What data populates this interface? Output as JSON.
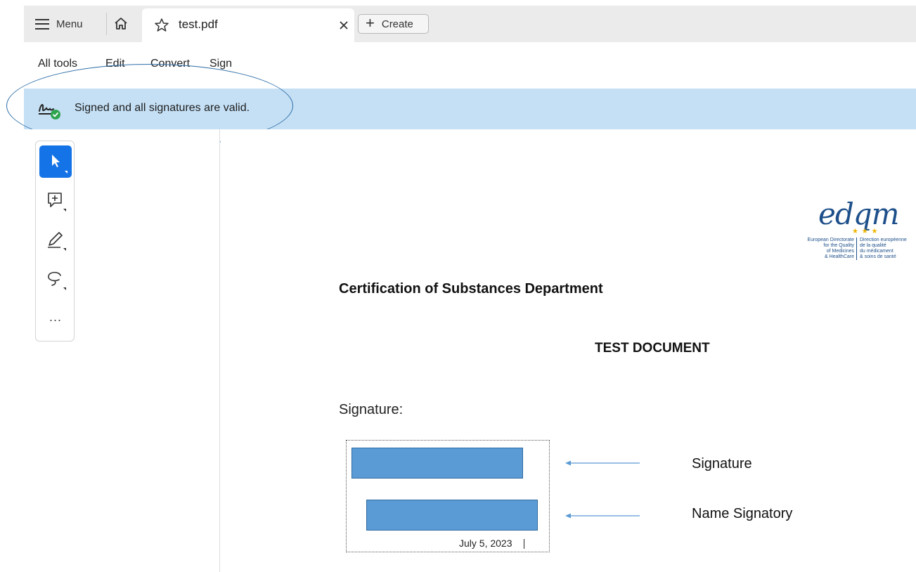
{
  "tabbar": {
    "menu_label": "Menu",
    "tab_title": "test.pdf",
    "create_label": "Create"
  },
  "menubar": {
    "items": [
      "All tools",
      "Edit",
      "Convert",
      "Sign"
    ]
  },
  "banner": {
    "text": "Signed and all signatures are valid."
  },
  "toolbar": {
    "tools": [
      "select-tool",
      "add-comment-tool",
      "draw-tool",
      "lasso-tool"
    ],
    "more": "..."
  },
  "document": {
    "logo": {
      "wordmark": "edqm",
      "left_lines": [
        "European Directorate",
        "for the Quality",
        "of Medicines",
        "& HealthCare"
      ],
      "right_lines": [
        "Direction européenne",
        "de la qualité",
        "du médicament",
        "& soins de santé"
      ]
    },
    "department": "Certification of Substances Department",
    "doc_title": "TEST DOCUMENT",
    "signature_label": "Signature:",
    "signature_date": "July 5, 2023",
    "annotations": {
      "signature": "Signature",
      "name_signatory": "Name Signatory"
    }
  },
  "colors": {
    "banner_bg": "#c5e0f5",
    "accent": "#1473e6",
    "sig_bar": "#5b9bd5",
    "annotation_line": "#2f6fa8",
    "valid_check": "#2da44e"
  }
}
